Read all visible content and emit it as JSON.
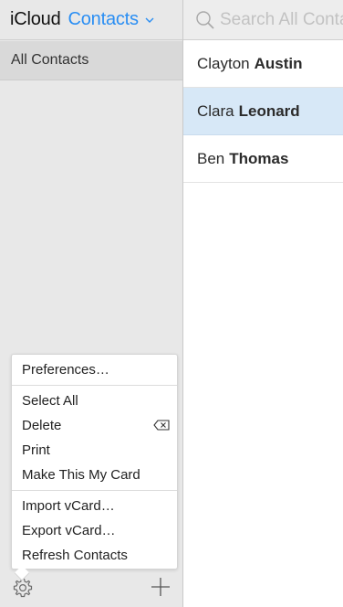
{
  "header": {
    "brand": "iCloud",
    "section": "Contacts"
  },
  "sidebar": {
    "groups": [
      {
        "label": "All Contacts",
        "selected": true
      }
    ]
  },
  "search": {
    "placeholder": "Search All Contacts",
    "value": ""
  },
  "contacts": [
    {
      "first": "Clayton",
      "last": "Austin",
      "selected": false
    },
    {
      "first": "Clara",
      "last": "Leonard",
      "selected": true
    },
    {
      "first": "Ben",
      "last": "Thomas",
      "selected": false
    }
  ],
  "menu": {
    "sections": [
      [
        {
          "label": "Preferences…"
        }
      ],
      [
        {
          "label": "Select All"
        },
        {
          "label": "Delete",
          "icon": "delete-key-icon"
        },
        {
          "label": "Print"
        },
        {
          "label": "Make This My Card"
        }
      ],
      [
        {
          "label": "Import vCard…"
        },
        {
          "label": "Export vCard…"
        },
        {
          "label": "Refresh Contacts"
        }
      ]
    ]
  },
  "footer": {
    "left_icon": "gear-icon",
    "right_icon": "plus-icon"
  },
  "colors": {
    "accent": "#2a8ef3",
    "selected_row": "#d7e8f7",
    "sidebar_bg": "#e8e8e8",
    "group_selected": "#d9d9d9"
  }
}
